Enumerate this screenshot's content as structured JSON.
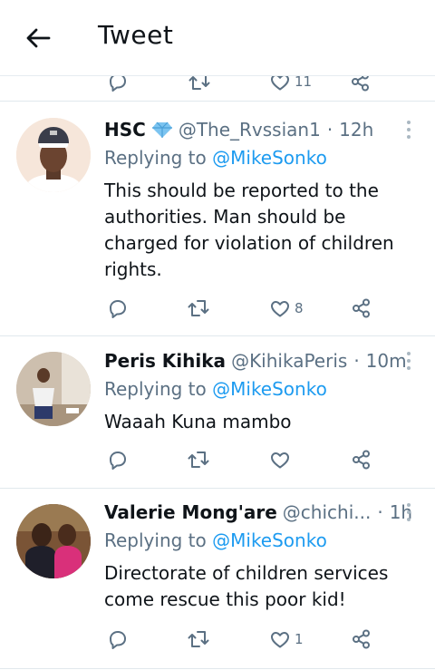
{
  "header": {
    "title": "Tweet",
    "back_icon": "arrow-left-icon"
  },
  "peek_action_bar": {
    "likes_count": "11"
  },
  "colors": {
    "mention": "#1d9bf0",
    "secondary_text": "#5b7083",
    "verified": "#54a9e8"
  },
  "replies": [
    {
      "name": "HSC",
      "badge_icon": "diamond-icon",
      "handle": "@The_Rvssian1",
      "time": "12h",
      "replying_prefix": "Replying to",
      "replying_to": "@MikeSonko",
      "text_lines": [
        "This should be reported to the",
        "authorities. Man should be",
        "charged for violation of children",
        "rights."
      ],
      "likes": "8"
    },
    {
      "name": "Peris Kihika",
      "handle": "@KihikaPeris",
      "time": "10m",
      "replying_prefix": "Replying to",
      "replying_to": "@MikeSonko",
      "text_lines": [
        "Waaah Kuna mambo"
      ],
      "likes": ""
    },
    {
      "name": "Valerie Mong'are",
      "handle": "@chichi...",
      "time": "1h",
      "replying_prefix": "Replying to",
      "replying_to": "@MikeSonko",
      "text_lines": [
        "Directorate of children services",
        "come rescue this poor kid!"
      ],
      "likes": "1"
    }
  ]
}
